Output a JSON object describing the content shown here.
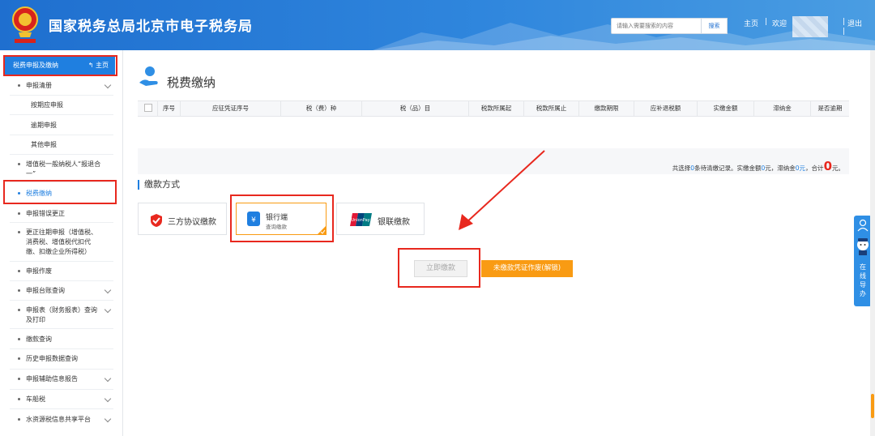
{
  "header": {
    "site_title": "国家税务总局北京市电子税务局",
    "search_placeholder": "请输入需要搜索的内容",
    "search_button": "搜索",
    "home_link": "主页",
    "separator": "|",
    "welcome": "欢迎",
    "logout": "退出",
    "brand_color": "#1f6fcf"
  },
  "sidebar": {
    "header_title": "税费申报及缴纳",
    "home_label": "主页",
    "items": [
      {
        "label": "申报清册",
        "expandable": true
      },
      {
        "label": "按期应申报",
        "sub": true
      },
      {
        "label": "逾期申报",
        "sub": true
      },
      {
        "label": "其他申报",
        "sub": true
      },
      {
        "label": "增值税一般纳税人“报退合一”",
        "expandable": false
      },
      {
        "label": "税费缴纳",
        "expandable": false,
        "active": true
      },
      {
        "label": "申报错误更正",
        "expandable": false
      },
      {
        "label": "更正往期申报（增值税、消费税、增值税代扣代缴、扣缴企业所得税）",
        "expandable": false
      },
      {
        "label": "申报作废",
        "expandable": false
      },
      {
        "label": "申报台账查询",
        "expandable": true
      },
      {
        "label": "申报表（财务报表）查询及打印",
        "expandable": true
      },
      {
        "label": "缴款查询",
        "expandable": false
      },
      {
        "label": "历史申报数据查询",
        "expandable": false
      },
      {
        "label": "申报辅助信息报告",
        "expandable": true
      },
      {
        "label": "车船税",
        "expandable": true
      },
      {
        "label": "水资源税信息共享平台",
        "expandable": true
      }
    ]
  },
  "main": {
    "page_title": "税费缴纳",
    "table_headers": [
      "序号",
      "应征凭证序号",
      "税（费）种",
      "税（品）目",
      "税款所属起",
      "税款所属止",
      "缴款期限",
      "应补退税额",
      "实缴金额",
      "滞纳金",
      "是否逾期"
    ],
    "summary": {
      "prefix": "共选择",
      "count": "0",
      "mid1": "条待清缴记录。实缴金额",
      "paid": "0",
      "mid2": "元，滞纳金",
      "late": "0元",
      "mid3": "，合计",
      "total": "0",
      "suffix": "元。"
    },
    "payment_method_label": "缴款方式",
    "methods": [
      {
        "label": "三方协议缴款",
        "icon": "shield-check-icon"
      },
      {
        "label": "银行端",
        "sub": "查询缴款",
        "icon": "money-bag-icon",
        "selected": true
      },
      {
        "label": "银联缴款",
        "icon": "unionpay-icon",
        "logo_text": "UnionPay"
      }
    ],
    "pay_now_button": "立即缴款",
    "unpaid_voucher_button": "未缴款凭证作废(解锁)"
  },
  "float_help": {
    "label": "在线导办"
  }
}
